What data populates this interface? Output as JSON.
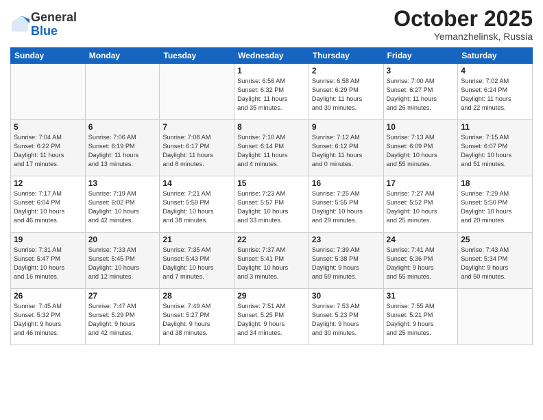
{
  "logo": {
    "general": "General",
    "blue": "Blue"
  },
  "header": {
    "month": "October 2025",
    "location": "Yemanzhelinsk, Russia"
  },
  "weekdays": [
    "Sunday",
    "Monday",
    "Tuesday",
    "Wednesday",
    "Thursday",
    "Friday",
    "Saturday"
  ],
  "weeks": [
    [
      {
        "day": "",
        "info": ""
      },
      {
        "day": "",
        "info": ""
      },
      {
        "day": "",
        "info": ""
      },
      {
        "day": "1",
        "info": "Sunrise: 6:56 AM\nSunset: 6:32 PM\nDaylight: 11 hours\nand 35 minutes."
      },
      {
        "day": "2",
        "info": "Sunrise: 6:58 AM\nSunset: 6:29 PM\nDaylight: 11 hours\nand 30 minutes."
      },
      {
        "day": "3",
        "info": "Sunrise: 7:00 AM\nSunset: 6:27 PM\nDaylight: 11 hours\nand 26 minutes."
      },
      {
        "day": "4",
        "info": "Sunrise: 7:02 AM\nSunset: 6:24 PM\nDaylight: 11 hours\nand 22 minutes."
      }
    ],
    [
      {
        "day": "5",
        "info": "Sunrise: 7:04 AM\nSunset: 6:22 PM\nDaylight: 11 hours\nand 17 minutes."
      },
      {
        "day": "6",
        "info": "Sunrise: 7:06 AM\nSunset: 6:19 PM\nDaylight: 11 hours\nand 13 minutes."
      },
      {
        "day": "7",
        "info": "Sunrise: 7:08 AM\nSunset: 6:17 PM\nDaylight: 11 hours\nand 8 minutes."
      },
      {
        "day": "8",
        "info": "Sunrise: 7:10 AM\nSunset: 6:14 PM\nDaylight: 11 hours\nand 4 minutes."
      },
      {
        "day": "9",
        "info": "Sunrise: 7:12 AM\nSunset: 6:12 PM\nDaylight: 11 hours\nand 0 minutes."
      },
      {
        "day": "10",
        "info": "Sunrise: 7:13 AM\nSunset: 6:09 PM\nDaylight: 10 hours\nand 55 minutes."
      },
      {
        "day": "11",
        "info": "Sunrise: 7:15 AM\nSunset: 6:07 PM\nDaylight: 10 hours\nand 51 minutes."
      }
    ],
    [
      {
        "day": "12",
        "info": "Sunrise: 7:17 AM\nSunset: 6:04 PM\nDaylight: 10 hours\nand 46 minutes."
      },
      {
        "day": "13",
        "info": "Sunrise: 7:19 AM\nSunset: 6:02 PM\nDaylight: 10 hours\nand 42 minutes."
      },
      {
        "day": "14",
        "info": "Sunrise: 7:21 AM\nSunset: 5:59 PM\nDaylight: 10 hours\nand 38 minutes."
      },
      {
        "day": "15",
        "info": "Sunrise: 7:23 AM\nSunset: 5:57 PM\nDaylight: 10 hours\nand 33 minutes."
      },
      {
        "day": "16",
        "info": "Sunrise: 7:25 AM\nSunset: 5:55 PM\nDaylight: 10 hours\nand 29 minutes."
      },
      {
        "day": "17",
        "info": "Sunrise: 7:27 AM\nSunset: 5:52 PM\nDaylight: 10 hours\nand 25 minutes."
      },
      {
        "day": "18",
        "info": "Sunrise: 7:29 AM\nSunset: 5:50 PM\nDaylight: 10 hours\nand 20 minutes."
      }
    ],
    [
      {
        "day": "19",
        "info": "Sunrise: 7:31 AM\nSunset: 5:47 PM\nDaylight: 10 hours\nand 16 minutes."
      },
      {
        "day": "20",
        "info": "Sunrise: 7:33 AM\nSunset: 5:45 PM\nDaylight: 10 hours\nand 12 minutes."
      },
      {
        "day": "21",
        "info": "Sunrise: 7:35 AM\nSunset: 5:43 PM\nDaylight: 10 hours\nand 7 minutes."
      },
      {
        "day": "22",
        "info": "Sunrise: 7:37 AM\nSunset: 5:41 PM\nDaylight: 10 hours\nand 3 minutes."
      },
      {
        "day": "23",
        "info": "Sunrise: 7:39 AM\nSunset: 5:38 PM\nDaylight: 9 hours\nand 59 minutes."
      },
      {
        "day": "24",
        "info": "Sunrise: 7:41 AM\nSunset: 5:36 PM\nDaylight: 9 hours\nand 55 minutes."
      },
      {
        "day": "25",
        "info": "Sunrise: 7:43 AM\nSunset: 5:34 PM\nDaylight: 9 hours\nand 50 minutes."
      }
    ],
    [
      {
        "day": "26",
        "info": "Sunrise: 7:45 AM\nSunset: 5:32 PM\nDaylight: 9 hours\nand 46 minutes."
      },
      {
        "day": "27",
        "info": "Sunrise: 7:47 AM\nSunset: 5:29 PM\nDaylight: 9 hours\nand 42 minutes."
      },
      {
        "day": "28",
        "info": "Sunrise: 7:49 AM\nSunset: 5:27 PM\nDaylight: 9 hours\nand 38 minutes."
      },
      {
        "day": "29",
        "info": "Sunrise: 7:51 AM\nSunset: 5:25 PM\nDaylight: 9 hours\nand 34 minutes."
      },
      {
        "day": "30",
        "info": "Sunrise: 7:53 AM\nSunset: 5:23 PM\nDaylight: 9 hours\nand 30 minutes."
      },
      {
        "day": "31",
        "info": "Sunrise: 7:55 AM\nSunset: 5:21 PM\nDaylight: 9 hours\nand 25 minutes."
      },
      {
        "day": "",
        "info": ""
      }
    ]
  ]
}
